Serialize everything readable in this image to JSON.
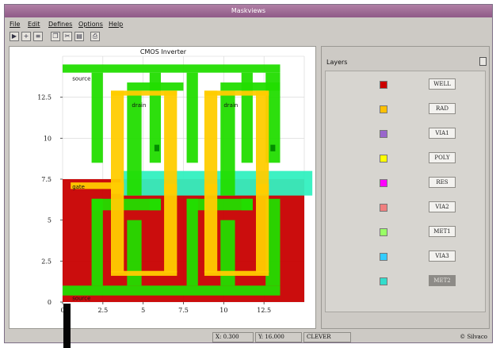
{
  "window": {
    "title": "Maskviews"
  },
  "menu": {
    "items": [
      {
        "label": "File"
      },
      {
        "label": "Edit"
      },
      {
        "label": "Defines"
      },
      {
        "label": "Options"
      },
      {
        "label": "Help"
      }
    ]
  },
  "toolbar": {
    "tools": [
      {
        "icon": "open-icon"
      },
      {
        "icon": "zoom-in-icon"
      },
      {
        "icon": "layers-icon"
      },
      {
        "icon": "copy-icon"
      },
      {
        "icon": "cut-icon"
      },
      {
        "icon": "paste-icon"
      },
      {
        "icon": "print-icon"
      }
    ]
  },
  "plot": {
    "title": "CMOS Inverter",
    "x_ticks": [
      "0",
      "2.5",
      "5",
      "7.5",
      "10",
      "12.5"
    ],
    "y_ticks": [
      "0",
      "2.5",
      "5",
      "7.5",
      "10",
      "12.5"
    ],
    "x_range": [
      0,
      15
    ],
    "y_range": [
      0,
      15
    ],
    "grid": true,
    "shapes": [
      {
        "layer": "WELL",
        "polys": [
          [
            0,
            0,
            15,
            7.5
          ]
        ]
      },
      {
        "layer": "MET2",
        "polys": [
          [
            3.6,
            6.5,
            15.5,
            8
          ]
        ]
      },
      {
        "layer": "MET1",
        "polys": [
          [
            0,
            14,
            13.5,
            14.5
          ],
          [
            1.8,
            8.5,
            2.5,
            14
          ],
          [
            5.4,
            8.5,
            6.1,
            14
          ],
          [
            7.7,
            8.5,
            8.4,
            14
          ],
          [
            11.1,
            8.5,
            11.8,
            14
          ],
          [
            12.6,
            8.5,
            13.5,
            14
          ],
          [
            4,
            12.9,
            7.5,
            13.4
          ],
          [
            9.8,
            12.9,
            13.5,
            13.4
          ],
          [
            4,
            6.5,
            4.9,
            12.9
          ],
          [
            9.8,
            6.5,
            10.7,
            12.9
          ],
          [
            0,
            0.4,
            13.5,
            1
          ],
          [
            1.8,
            1,
            2.5,
            6.3
          ],
          [
            4,
            1,
            4.9,
            5
          ],
          [
            7.7,
            1,
            8.4,
            6.3
          ],
          [
            9.8,
            1,
            10.7,
            5
          ],
          [
            12.6,
            1,
            13.5,
            6.3
          ],
          [
            5.4,
            5.6,
            6.1,
            6.3
          ],
          [
            11.1,
            5.6,
            11.8,
            6.3
          ],
          [
            1.8,
            5.6,
            6.1,
            6.3
          ],
          [
            7.7,
            5.6,
            11.8,
            6.3
          ]
        ]
      },
      {
        "layer": "POLY",
        "polys": [
          [
            3,
            6.6,
            3.8,
            12.9
          ],
          [
            6.3,
            6.6,
            7.1,
            12.9
          ],
          [
            8.8,
            6.6,
            9.6,
            12.9
          ],
          [
            12,
            6.6,
            12.8,
            12.9
          ],
          [
            3,
            1.8,
            3.8,
            7.2
          ],
          [
            6.3,
            1.8,
            7.1,
            7.2
          ],
          [
            8.8,
            1.8,
            9.6,
            7.2
          ],
          [
            12,
            1.8,
            12.8,
            7.2
          ],
          [
            3,
            12.6,
            7.1,
            12.9
          ],
          [
            8.8,
            12.6,
            12.8,
            12.9
          ],
          [
            3,
            1.6,
            7.1,
            1.9
          ],
          [
            8.8,
            1.6,
            12.8,
            1.9
          ],
          [
            0.5,
            6.9,
            3.8,
            7.3
          ]
        ]
      },
      {
        "layer": "VIA1",
        "polys": [
          [
            5.7,
            9.2,
            6.0,
            9.6
          ],
          [
            12.9,
            9.2,
            13.2,
            9.6
          ]
        ]
      }
    ],
    "labels": [
      {
        "text": "source",
        "x": 0.6,
        "y": 13.9
      },
      {
        "text": "drain",
        "x": 4.3,
        "y": 12.3
      },
      {
        "text": "drain",
        "x": 10.0,
        "y": 12.3
      },
      {
        "text": "gate",
        "x": 0.6,
        "y": 7.3
      },
      {
        "text": "source",
        "x": 0.6,
        "y": 0.5
      }
    ]
  },
  "layers": {
    "title": "Layers",
    "items": [
      {
        "name": "WELL",
        "color": "#cc0000"
      },
      {
        "name": "RAD",
        "color": "#ffc000"
      },
      {
        "name": "VIA1",
        "color": "#9966cc"
      },
      {
        "name": "POLY",
        "color": "#ffff00"
      },
      {
        "name": "RES",
        "color": "#ff00ff"
      },
      {
        "name": "VIA2",
        "color": "#f07f7f"
      },
      {
        "name": "MET1",
        "color": "#99ff66"
      },
      {
        "name": "VIA3",
        "color": "#33ccff"
      },
      {
        "name": "MET2",
        "color": "#33ddcc",
        "selected": true
      }
    ]
  },
  "layer_colors": {
    "WELL": "#c80000",
    "POLY": "#ffcc00",
    "MET1": "#22dd00",
    "MET2": "#33f0c0",
    "VIA1": "#008800"
  },
  "status": {
    "x": "X: 0.300",
    "y": "Y: 16.000",
    "mode": "CLEVER",
    "credit": "© Silvaco"
  }
}
